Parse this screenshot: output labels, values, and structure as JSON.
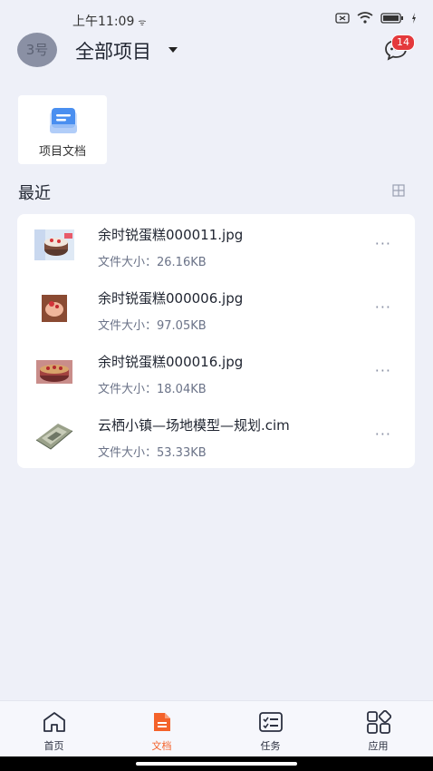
{
  "status": {
    "time": "上午11:09"
  },
  "header": {
    "avatar_text": "3号",
    "project_title": "全部项目",
    "message_badge": "14"
  },
  "quick_entry": {
    "label": "项目文档"
  },
  "recent": {
    "title": "最近",
    "files": [
      {
        "name": "余时锐蛋糕000011.jpg",
        "size": "文件大小：26.16KB"
      },
      {
        "name": "余时锐蛋糕000006.jpg",
        "size": "文件大小：97.05KB"
      },
      {
        "name": "余时锐蛋糕000016.jpg",
        "size": "文件大小：18.04KB"
      },
      {
        "name": "云栖小镇—场地模型—规划.cim",
        "size": "文件大小：53.33KB"
      }
    ],
    "more_glyph": "···"
  },
  "tabbar": {
    "tabs": [
      {
        "label": "首页"
      },
      {
        "label": "文档"
      },
      {
        "label": "任务"
      },
      {
        "label": "应用"
      }
    ]
  },
  "colors": {
    "accent": "#f4622a",
    "badge": "#e4393c",
    "doc_icon": "#4a8ff0"
  }
}
